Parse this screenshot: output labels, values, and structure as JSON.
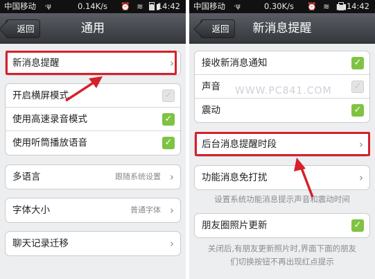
{
  "left": {
    "status": {
      "carrier": "中国移动",
      "usb": "⋅ψ",
      "speed": "0.14K/s",
      "icons": "⏰ ≋ ▮▮",
      "time": "14:42"
    },
    "back_label": "返回",
    "title": "通用",
    "rows": {
      "new_msg": "新消息提醒",
      "landscape": "开启横屏模式",
      "hq_record": "使用高速录音模式",
      "earpiece": "使用听筒播放语音",
      "language": "多语言",
      "language_value": "跟随系统设置",
      "font_size": "字体大小",
      "font_size_value": "普通字体",
      "chat_migrate": "聊天记录迁移"
    },
    "checks": {
      "landscape": false,
      "hq_record": true,
      "earpiece": true
    }
  },
  "right": {
    "status": {
      "carrier": "中国移动",
      "usb": "⋅ψ",
      "speed": "0.30K/s",
      "icons": "⏰ ≋ ▮▮",
      "time": "14:42"
    },
    "back_label": "返回",
    "title": "新消息提醒",
    "rows": {
      "receive": "接收新消息通知",
      "sound": "声音",
      "vibrate": "震动",
      "bg_period": "后台消息提醒时段",
      "dnd": "功能消息免打扰",
      "moments": "朋友圈照片更新"
    },
    "checks": {
      "receive": true,
      "sound": false,
      "vibrate": true,
      "moments": true
    },
    "note1": "设置系统功能消息提示声音和震动时间",
    "note2_line1": "关闭后,有朋友更新照片时,界面下面的朋友",
    "note2_line2": "们切换按钮不再出现红点提示",
    "watermark": "WWW.PC841.COM"
  },
  "colors": {
    "highlight": "#d6202a",
    "check_on": "#7fc343",
    "navbar": "#45484d"
  },
  "icons": {
    "chevron": "chevron-right-icon",
    "check": "checkmark-icon",
    "arrow": "red-arrow-annotation"
  }
}
